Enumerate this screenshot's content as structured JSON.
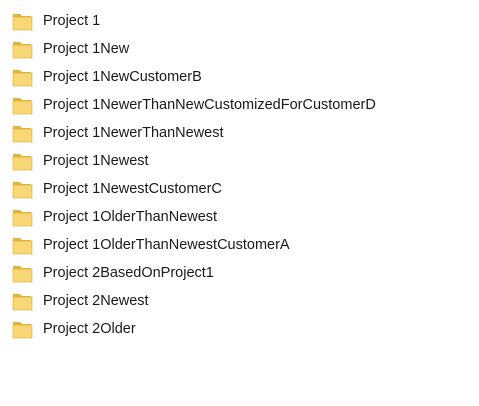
{
  "folders": [
    {
      "name": "Project 1",
      "icon": "folder-icon"
    },
    {
      "name": "Project 1New",
      "icon": "folder-icon"
    },
    {
      "name": "Project 1NewCustomerB",
      "icon": "folder-icon"
    },
    {
      "name": "Project 1NewerThanNewCustomizedForCustomerD",
      "icon": "folder-icon"
    },
    {
      "name": "Project 1NewerThanNewest",
      "icon": "folder-icon"
    },
    {
      "name": "Project 1Newest",
      "icon": "folder-icon"
    },
    {
      "name": "Project 1NewestCustomerC",
      "icon": "folder-icon"
    },
    {
      "name": "Project 1OlderThanNewest",
      "icon": "folder-icon"
    },
    {
      "name": "Project 1OlderThanNewestCustomerA",
      "icon": "folder-icon"
    },
    {
      "name": "Project 2BasedOnProject1",
      "icon": "folder-icon"
    },
    {
      "name": "Project 2Newest",
      "icon": "folder-icon"
    },
    {
      "name": "Project 2Older",
      "icon": "folder-icon"
    }
  ],
  "colors": {
    "folder_body": "#f8d775",
    "folder_back": "#e2b33f",
    "folder_edge": "#d9a936"
  }
}
